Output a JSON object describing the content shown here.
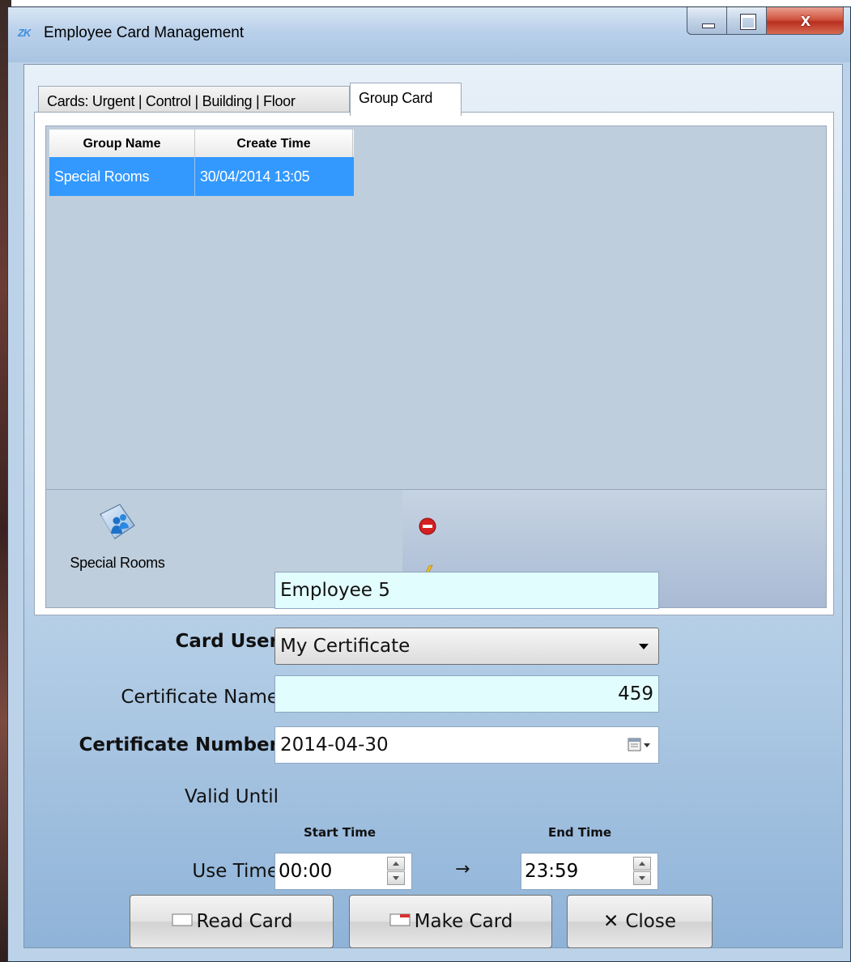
{
  "window": {
    "logo": "ZK",
    "title": "Employee Card Management",
    "close_glyph": "x"
  },
  "tabs": [
    {
      "label": "Cards: Urgent | Control | Building | Floor",
      "active": false
    },
    {
      "label": "Group Card",
      "active": true
    }
  ],
  "grid": {
    "columns": [
      "Group Name",
      "Create Time"
    ],
    "rows": [
      {
        "group_name": "Special Rooms",
        "create_time": "30/04/2014 13:05",
        "selected": true
      }
    ]
  },
  "group_panel": {
    "icon": "group-card-icon",
    "label": "Special Rooms",
    "actions": [
      {
        "icon": "remove-icon"
      },
      {
        "icon": "clear-icon"
      }
    ]
  },
  "form": {
    "card_user_label": "Card User",
    "card_user_value": "Employee 5",
    "certificate_name_label": "Certificate Name",
    "certificate_name_value": "My Certificate",
    "certificate_number_label": "Certificate Number",
    "certificate_number_value": "459",
    "valid_until_label": "Valid Until",
    "valid_until_value": "2014-04-30",
    "use_time_label": "Use Time",
    "start_time_label": "Start Time",
    "start_time_value": "00:00",
    "end_time_label": "End Time",
    "end_time_value": "23:59",
    "arrow": "→"
  },
  "buttons": {
    "read_card": "Read Card",
    "make_card": "Make Card",
    "close": "Close",
    "close_glyph": "✕"
  },
  "colors": {
    "selection": "#3399ff",
    "required_field_bg": "#e2fdfd",
    "close_button": "#c8412e"
  }
}
